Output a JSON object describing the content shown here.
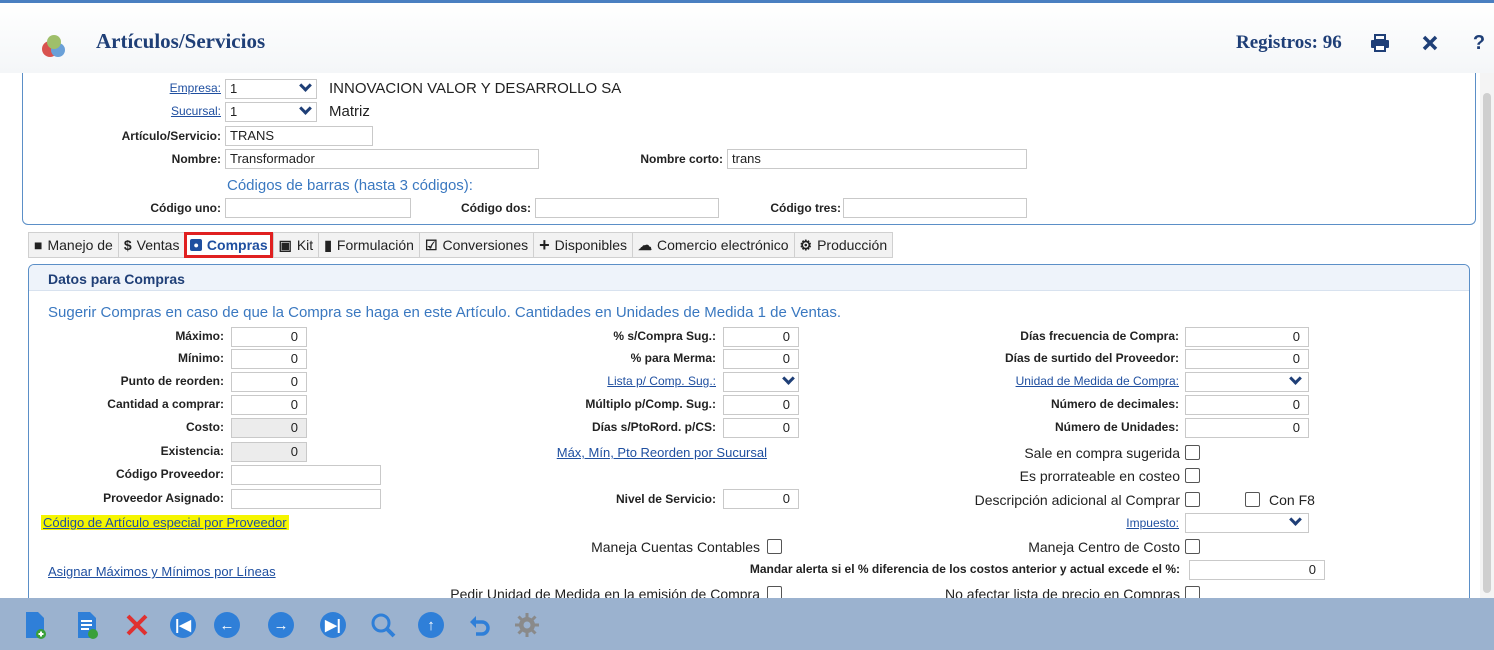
{
  "header": {
    "title": "Artículos/Servicios",
    "records": "Registros: 96"
  },
  "top_form": {
    "empresa_label": "Empresa:",
    "empresa_value": "1",
    "empresa_name": "INNOVACION VALOR Y DESARROLLO SA",
    "sucursal_label": "Sucursal:",
    "sucursal_value": "1",
    "sucursal_name": "Matriz",
    "articulo_label": "Artículo/Servicio:",
    "articulo_value": "TRANS",
    "nombre_label": "Nombre:",
    "nombre_value": "Transformador",
    "nombre_corto_label": "Nombre corto:",
    "nombre_corto_value": "trans",
    "barcodes_heading": "Códigos de barras (hasta 3 códigos):",
    "codigo_uno_label": "Código uno:",
    "codigo_uno_value": "",
    "codigo_dos_label": "Código dos:",
    "codigo_dos_value": "",
    "codigo_tres_label": "Código tres:",
    "codigo_tres_value": ""
  },
  "tabs": [
    {
      "label": "Manejo de",
      "icon": "briefcase-icon"
    },
    {
      "label": "Ventas",
      "icon": "dollar-icon"
    },
    {
      "label": "Compras",
      "icon": "banknote-icon",
      "active": true
    },
    {
      "label": "Kit",
      "icon": "kit-icon"
    },
    {
      "label": "Formulación",
      "icon": "clipboard-icon"
    },
    {
      "label": "Conversiones",
      "icon": "clipboard-check-icon"
    },
    {
      "label": "Disponibles",
      "icon": "plus-icon"
    },
    {
      "label": "Comercio electrónico",
      "icon": "cloud-icon"
    },
    {
      "label": "Producción",
      "icon": "cogs-icon"
    }
  ],
  "compras": {
    "title": "Datos para Compras",
    "subtitle": "Sugerir Compras en caso de que la Compra se haga en este Artículo. Cantidades en Unidades de Medida 1 de Ventas.",
    "col1": {
      "maximo_label": "Máximo:",
      "maximo_value": "0",
      "minimo_label": "Mínimo:",
      "minimo_value": "0",
      "reorden_label": "Punto de reorden:",
      "reorden_value": "0",
      "cantidad_label": "Cantidad a comprar:",
      "cantidad_value": "0",
      "costo_label": "Costo:",
      "costo_value": "0",
      "existencia_label": "Existencia:",
      "existencia_value": "0",
      "cod_prov_label": "Código Proveedor:",
      "cod_prov_value": "",
      "prov_asig_label": "Proveedor Asignado:",
      "prov_asig_value": "",
      "cod_especial_link": "Código de Artículo especial por Proveedor",
      "asignar_link": "Asignar Máximos y Mínimos por Líneas"
    },
    "col2": {
      "pct_compra_label": "% s/Compra Sug.:",
      "pct_compra_value": "0",
      "pct_merma_label": "% para Merma:",
      "pct_merma_value": "0",
      "lista_label": "Lista p/ Comp. Sug.:",
      "multiplo_label": "Múltiplo p/Comp. Sug.:",
      "multiplo_value": "0",
      "dias_pto_label": "Días s/PtoRord. p/CS:",
      "dias_pto_value": "0",
      "maxmin_link": "Máx, Mín, Pto Reorden por Sucursal",
      "nivel_label": "Nivel de Servicio:",
      "nivel_value": "0",
      "maneja_ctas_label": "Maneja Cuentas Contables",
      "pedir_um_label": "Pedir Unidad de Medida en la emisión de Compra"
    },
    "col3": {
      "dias_frec_label": "Días frecuencia de Compra:",
      "dias_frec_value": "0",
      "dias_surt_label": "Días de surtido del Proveedor:",
      "dias_surt_value": "0",
      "unidad_label": "Unidad de Medida de Compra:",
      "decimales_label": "Número de decimales:",
      "decimales_value": "0",
      "unidades_label": "Número de Unidades:",
      "unidades_value": "0",
      "sale_sugerida_label": "Sale en compra sugerida",
      "prorrateable_label": "Es prorrateable en costeo",
      "desc_adicional_label": "Descripción adicional al Comprar",
      "con_f8_label": "Con F8",
      "impuesto_label": "Impuesto:",
      "maneja_cc_label": "Maneja Centro de Costo",
      "alerta_label": "Mandar alerta si el % diferencia de los costos anterior y actual excede el %:",
      "alerta_value": "0",
      "no_afectar_label": "No afectar lista de precio en Compras"
    }
  },
  "toolbar": [
    "new-document-icon",
    "add-document-icon",
    "delete-icon",
    "first-record-icon",
    "previous-record-icon",
    "next-record-icon",
    "last-record-icon",
    "search-icon",
    "upload-icon",
    "undo-icon",
    "settings-icon"
  ],
  "colors": {
    "accent": "#1f3f77",
    "link": "#1f4fa0",
    "highlight": "#f5f500",
    "active_tab_border": "#e02020",
    "toolbar_bg": "#9bb2cf"
  }
}
